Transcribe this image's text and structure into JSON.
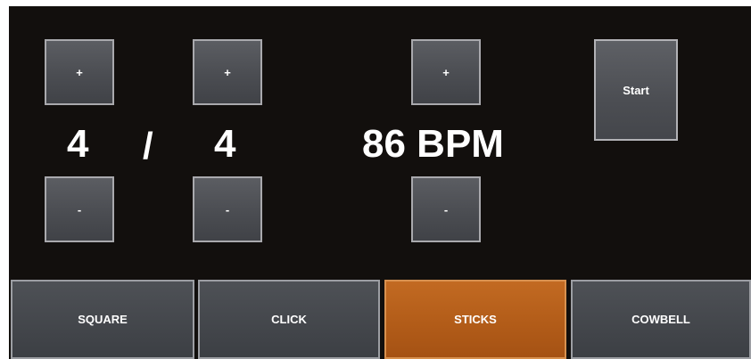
{
  "time_signature": {
    "numerator": "4",
    "separator": "/",
    "denominator": "4",
    "numerator_plus_label": "+",
    "numerator_minus_label": "-",
    "denominator_plus_label": "+",
    "denominator_minus_label": "-"
  },
  "tempo": {
    "display": "86 BPM",
    "plus_label": "+",
    "minus_label": "-"
  },
  "transport": {
    "start_label": "Start"
  },
  "sounds": {
    "items": [
      {
        "label": "SQUARE",
        "active": false
      },
      {
        "label": "CLICK",
        "active": false
      },
      {
        "label": "STICKS",
        "active": true
      },
      {
        "label": "COWBELL",
        "active": false
      }
    ],
    "active_color": "#b15b18",
    "inactive_color": "#43464b"
  }
}
